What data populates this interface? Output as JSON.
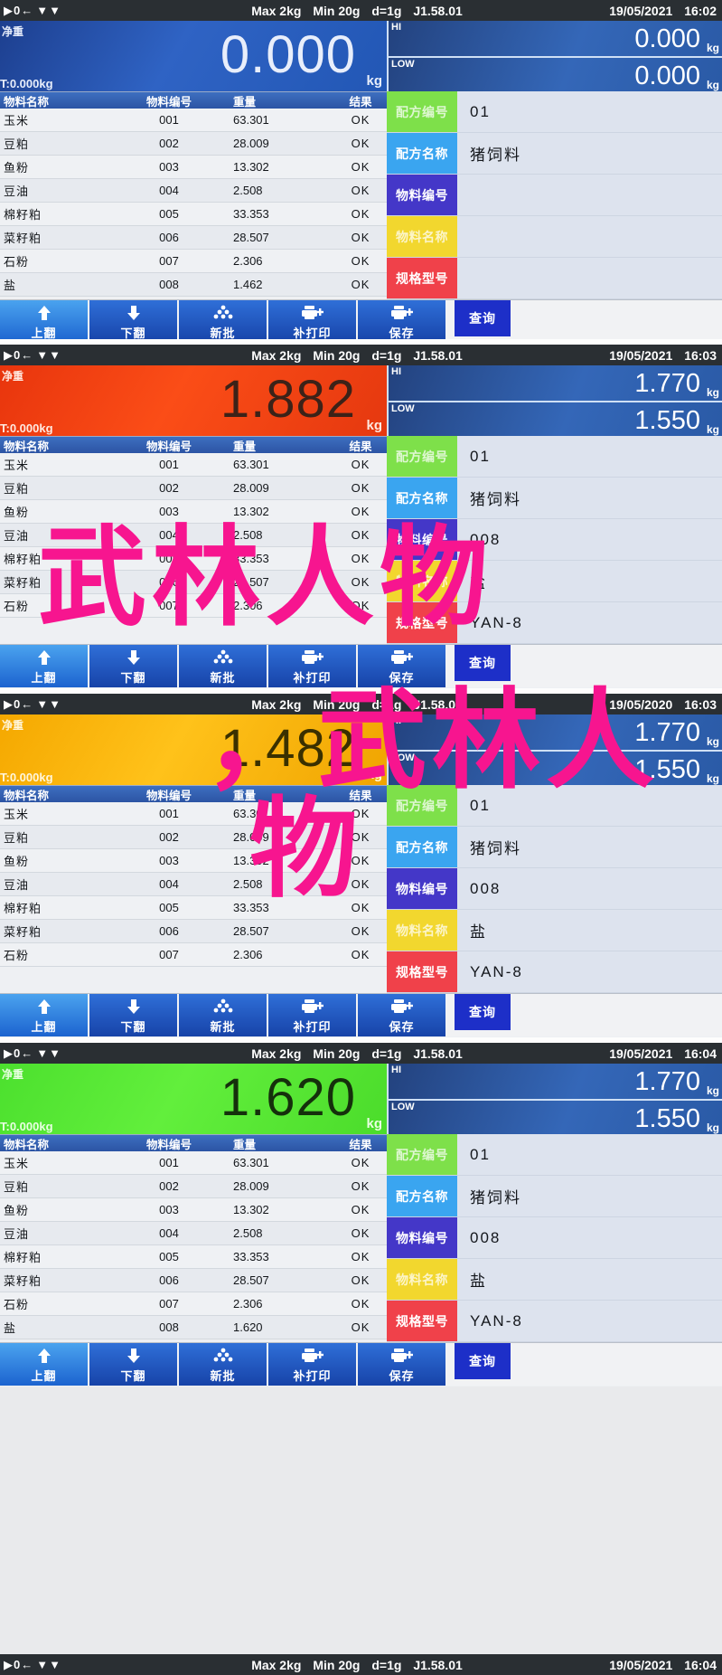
{
  "meta": {
    "device": "weighing-batching-terminal",
    "unit": "kg",
    "watermark": {
      "line1": "武林人物",
      "line2": "，武林人",
      "line3": "物",
      "color": "#f7158f"
    }
  },
  "statusbar": {
    "zero_icon": "zero-indicator-icon",
    "arrow_icon": "tare-arrow-icon",
    "stable_icon": "stability-icon",
    "max": "Max 2kg",
    "min": "Min 20g",
    "division": "d=1g",
    "version": "J1.58.01"
  },
  "labels": {
    "net": "净重",
    "tare": "T:0.000kg",
    "hi": "HI",
    "low": "LOW",
    "unit": "kg"
  },
  "table": {
    "headers": [
      "物料名称",
      "物料编号",
      "重量",
      "结果"
    ],
    "rows": [
      {
        "name": "玉米",
        "code": "001",
        "weight": "63.301",
        "result": "OK"
      },
      {
        "name": "豆粕",
        "code": "002",
        "weight": "28.009",
        "result": "OK"
      },
      {
        "name": "鱼粉",
        "code": "003",
        "weight": "13.302",
        "result": "OK"
      },
      {
        "name": "豆油",
        "code": "004",
        "weight": "2.508",
        "result": "OK"
      },
      {
        "name": "棉籽粕",
        "code": "005",
        "weight": "33.353",
        "result": "OK"
      },
      {
        "name": "菜籽粕",
        "code": "006",
        "weight": "28.507",
        "result": "OK"
      },
      {
        "name": "石粉",
        "code": "007",
        "weight": "2.306",
        "result": "OK"
      },
      {
        "name": "盐",
        "code": "008",
        "weight": "1.462",
        "result": "OK"
      }
    ],
    "rows_last": [
      {
        "name": "玉米",
        "code": "001",
        "weight": "63.301",
        "result": "OK"
      },
      {
        "name": "豆粕",
        "code": "002",
        "weight": "28.009",
        "result": "OK"
      },
      {
        "name": "鱼粉",
        "code": "003",
        "weight": "13.302",
        "result": "OK"
      },
      {
        "name": "豆油",
        "code": "004",
        "weight": "2.508",
        "result": "OK"
      },
      {
        "name": "棉籽粕",
        "code": "005",
        "weight": "33.353",
        "result": "OK"
      },
      {
        "name": "菜籽粕",
        "code": "006",
        "weight": "28.507",
        "result": "OK"
      },
      {
        "name": "石粉",
        "code": "007",
        "weight": "2.306",
        "result": "OK"
      },
      {
        "name": "盐",
        "code": "008",
        "weight": "1.620",
        "result": "OK"
      }
    ]
  },
  "form_tags": {
    "recipe_no": {
      "label": "配方编号",
      "color": "#7ee04a"
    },
    "recipe_name": {
      "label": "配方名称",
      "color": "#3aa5f0"
    },
    "material_no": {
      "label": "物料编号",
      "color": "#4437c8"
    },
    "material_name": {
      "label": "物料名称",
      "color": "#f2d72e"
    },
    "spec_model": {
      "label": "规格型号",
      "color": "#f0414a"
    }
  },
  "toolbar": {
    "buttons": [
      {
        "label": "上翻",
        "icon": "arrow-up-icon"
      },
      {
        "label": "下翻",
        "icon": "arrow-down-icon"
      },
      {
        "label": "新批",
        "icon": "new-batch-stack-icon"
      },
      {
        "label": "补打印",
        "icon": "reprint-printer-plus-icon"
      },
      {
        "label": "保存",
        "icon": "save-printer-plus-icon"
      }
    ],
    "query_label": "查询"
  },
  "panels": [
    {
      "id": "panel-1",
      "datetime": "19/05/2021  16:02",
      "date": "19/05/2021",
      "time": "16:02",
      "weight": "0.000",
      "weight_color": "blue",
      "hi": "0.000",
      "low": "0.000",
      "recipe_no": "01",
      "recipe_name": "猪饲料",
      "material_no": "",
      "material_name": "",
      "spec_model": ""
    },
    {
      "id": "panel-2",
      "datetime": "19/05/2021  16:03",
      "date": "19/05/2021",
      "time": "16:03",
      "weight": "1.882",
      "weight_color": "red",
      "hi": "1.770",
      "low": "1.550",
      "recipe_no": "01",
      "recipe_name": "猪饲料",
      "material_no": "008",
      "material_name": "盐",
      "spec_model": "YAN-8"
    },
    {
      "id": "panel-3",
      "datetime": "19/05/2020  16:03",
      "date": "19/05/2020",
      "time": "16:03",
      "weight": "1.482",
      "weight_color": "orange",
      "hi": "1.770",
      "low": "1.550",
      "recipe_no": "01",
      "recipe_name": "猪饲料",
      "material_no": "008",
      "material_name": "盐",
      "spec_model": "YAN-8"
    },
    {
      "id": "panel-4",
      "datetime": "19/05/2021  16:04",
      "date": "19/05/2021",
      "time": "16:04",
      "weight": "1.620",
      "weight_color": "green",
      "hi": "1.770",
      "low": "1.550",
      "recipe_no": "01",
      "recipe_name": "猪饲料",
      "material_no": "008",
      "material_name": "盐",
      "spec_model": "YAN-8"
    }
  ],
  "bottom_strip": {
    "date": "19/05/2021",
    "time": "16:04"
  }
}
